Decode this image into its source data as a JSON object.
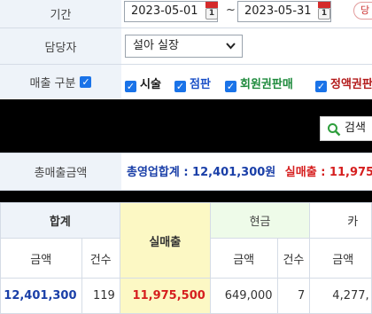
{
  "filters": {
    "period_label": "기간",
    "start_date": "2023-05-01",
    "end_date": "2023-05-31",
    "calendar_icon_text": "1",
    "tilde": "~",
    "extra_button_label": "당",
    "manager_label": "담당자",
    "manager_value": "설아 실장",
    "sales_type_label": "매출 구분",
    "sales_types": [
      {
        "label": "시술",
        "color": "#1a1a1a"
      },
      {
        "label": "점판",
        "color": "#1a4fc7"
      },
      {
        "label": "회원권판매",
        "color": "#1e8a3c"
      },
      {
        "label": "정액권판",
        "color": "#b31b1b"
      }
    ]
  },
  "search": {
    "button_label": "검색"
  },
  "summary": {
    "label": "총매출금액",
    "total_text": "총영업합계 : 12,401,300원",
    "real_text": "실매출 : 11,975",
    "total_color": "#1a3fa8",
    "real_color": "#d61f1f"
  },
  "table": {
    "headers": {
      "total": "합계",
      "real_sales": "실매출",
      "cash": "현금",
      "card": "카",
      "amount": "금액",
      "count": "건수"
    },
    "row": {
      "total_amount": "12,401,300",
      "total_count": "119",
      "real_sales": "11,975,500",
      "cash_amount": "649,000",
      "cash_count": "7",
      "card_amount": "4,277,"
    }
  }
}
